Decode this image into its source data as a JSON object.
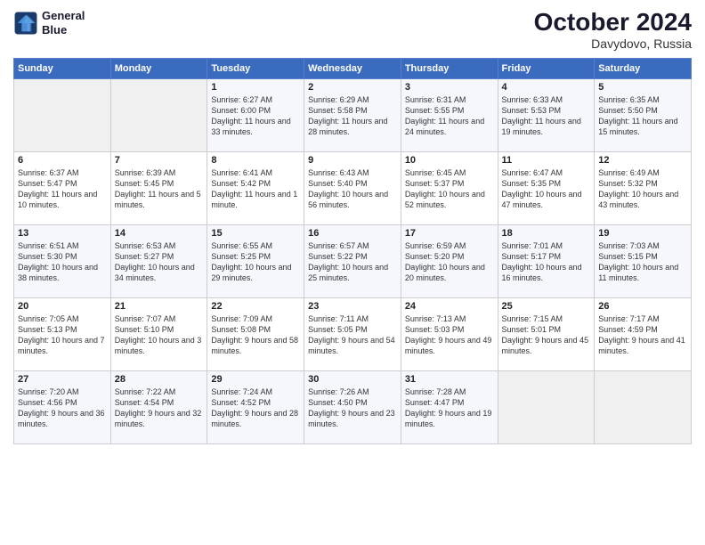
{
  "header": {
    "logo_line1": "General",
    "logo_line2": "Blue",
    "month": "October 2024",
    "location": "Davydovo, Russia"
  },
  "days_of_week": [
    "Sunday",
    "Monday",
    "Tuesday",
    "Wednesday",
    "Thursday",
    "Friday",
    "Saturday"
  ],
  "weeks": [
    [
      {
        "day": "",
        "sunrise": "",
        "sunset": "",
        "daylight": ""
      },
      {
        "day": "",
        "sunrise": "",
        "sunset": "",
        "daylight": ""
      },
      {
        "day": "1",
        "sunrise": "Sunrise: 6:27 AM",
        "sunset": "Sunset: 6:00 PM",
        "daylight": "Daylight: 11 hours and 33 minutes."
      },
      {
        "day": "2",
        "sunrise": "Sunrise: 6:29 AM",
        "sunset": "Sunset: 5:58 PM",
        "daylight": "Daylight: 11 hours and 28 minutes."
      },
      {
        "day": "3",
        "sunrise": "Sunrise: 6:31 AM",
        "sunset": "Sunset: 5:55 PM",
        "daylight": "Daylight: 11 hours and 24 minutes."
      },
      {
        "day": "4",
        "sunrise": "Sunrise: 6:33 AM",
        "sunset": "Sunset: 5:53 PM",
        "daylight": "Daylight: 11 hours and 19 minutes."
      },
      {
        "day": "5",
        "sunrise": "Sunrise: 6:35 AM",
        "sunset": "Sunset: 5:50 PM",
        "daylight": "Daylight: 11 hours and 15 minutes."
      }
    ],
    [
      {
        "day": "6",
        "sunrise": "Sunrise: 6:37 AM",
        "sunset": "Sunset: 5:47 PM",
        "daylight": "Daylight: 11 hours and 10 minutes."
      },
      {
        "day": "7",
        "sunrise": "Sunrise: 6:39 AM",
        "sunset": "Sunset: 5:45 PM",
        "daylight": "Daylight: 11 hours and 5 minutes."
      },
      {
        "day": "8",
        "sunrise": "Sunrise: 6:41 AM",
        "sunset": "Sunset: 5:42 PM",
        "daylight": "Daylight: 11 hours and 1 minute."
      },
      {
        "day": "9",
        "sunrise": "Sunrise: 6:43 AM",
        "sunset": "Sunset: 5:40 PM",
        "daylight": "Daylight: 10 hours and 56 minutes."
      },
      {
        "day": "10",
        "sunrise": "Sunrise: 6:45 AM",
        "sunset": "Sunset: 5:37 PM",
        "daylight": "Daylight: 10 hours and 52 minutes."
      },
      {
        "day": "11",
        "sunrise": "Sunrise: 6:47 AM",
        "sunset": "Sunset: 5:35 PM",
        "daylight": "Daylight: 10 hours and 47 minutes."
      },
      {
        "day": "12",
        "sunrise": "Sunrise: 6:49 AM",
        "sunset": "Sunset: 5:32 PM",
        "daylight": "Daylight: 10 hours and 43 minutes."
      }
    ],
    [
      {
        "day": "13",
        "sunrise": "Sunrise: 6:51 AM",
        "sunset": "Sunset: 5:30 PM",
        "daylight": "Daylight: 10 hours and 38 minutes."
      },
      {
        "day": "14",
        "sunrise": "Sunrise: 6:53 AM",
        "sunset": "Sunset: 5:27 PM",
        "daylight": "Daylight: 10 hours and 34 minutes."
      },
      {
        "day": "15",
        "sunrise": "Sunrise: 6:55 AM",
        "sunset": "Sunset: 5:25 PM",
        "daylight": "Daylight: 10 hours and 29 minutes."
      },
      {
        "day": "16",
        "sunrise": "Sunrise: 6:57 AM",
        "sunset": "Sunset: 5:22 PM",
        "daylight": "Daylight: 10 hours and 25 minutes."
      },
      {
        "day": "17",
        "sunrise": "Sunrise: 6:59 AM",
        "sunset": "Sunset: 5:20 PM",
        "daylight": "Daylight: 10 hours and 20 minutes."
      },
      {
        "day": "18",
        "sunrise": "Sunrise: 7:01 AM",
        "sunset": "Sunset: 5:17 PM",
        "daylight": "Daylight: 10 hours and 16 minutes."
      },
      {
        "day": "19",
        "sunrise": "Sunrise: 7:03 AM",
        "sunset": "Sunset: 5:15 PM",
        "daylight": "Daylight: 10 hours and 11 minutes."
      }
    ],
    [
      {
        "day": "20",
        "sunrise": "Sunrise: 7:05 AM",
        "sunset": "Sunset: 5:13 PM",
        "daylight": "Daylight: 10 hours and 7 minutes."
      },
      {
        "day": "21",
        "sunrise": "Sunrise: 7:07 AM",
        "sunset": "Sunset: 5:10 PM",
        "daylight": "Daylight: 10 hours and 3 minutes."
      },
      {
        "day": "22",
        "sunrise": "Sunrise: 7:09 AM",
        "sunset": "Sunset: 5:08 PM",
        "daylight": "Daylight: 9 hours and 58 minutes."
      },
      {
        "day": "23",
        "sunrise": "Sunrise: 7:11 AM",
        "sunset": "Sunset: 5:05 PM",
        "daylight": "Daylight: 9 hours and 54 minutes."
      },
      {
        "day": "24",
        "sunrise": "Sunrise: 7:13 AM",
        "sunset": "Sunset: 5:03 PM",
        "daylight": "Daylight: 9 hours and 49 minutes."
      },
      {
        "day": "25",
        "sunrise": "Sunrise: 7:15 AM",
        "sunset": "Sunset: 5:01 PM",
        "daylight": "Daylight: 9 hours and 45 minutes."
      },
      {
        "day": "26",
        "sunrise": "Sunrise: 7:17 AM",
        "sunset": "Sunset: 4:59 PM",
        "daylight": "Daylight: 9 hours and 41 minutes."
      }
    ],
    [
      {
        "day": "27",
        "sunrise": "Sunrise: 7:20 AM",
        "sunset": "Sunset: 4:56 PM",
        "daylight": "Daylight: 9 hours and 36 minutes."
      },
      {
        "day": "28",
        "sunrise": "Sunrise: 7:22 AM",
        "sunset": "Sunset: 4:54 PM",
        "daylight": "Daylight: 9 hours and 32 minutes."
      },
      {
        "day": "29",
        "sunrise": "Sunrise: 7:24 AM",
        "sunset": "Sunset: 4:52 PM",
        "daylight": "Daylight: 9 hours and 28 minutes."
      },
      {
        "day": "30",
        "sunrise": "Sunrise: 7:26 AM",
        "sunset": "Sunset: 4:50 PM",
        "daylight": "Daylight: 9 hours and 23 minutes."
      },
      {
        "day": "31",
        "sunrise": "Sunrise: 7:28 AM",
        "sunset": "Sunset: 4:47 PM",
        "daylight": "Daylight: 9 hours and 19 minutes."
      },
      {
        "day": "",
        "sunrise": "",
        "sunset": "",
        "daylight": ""
      },
      {
        "day": "",
        "sunrise": "",
        "sunset": "",
        "daylight": ""
      }
    ]
  ]
}
